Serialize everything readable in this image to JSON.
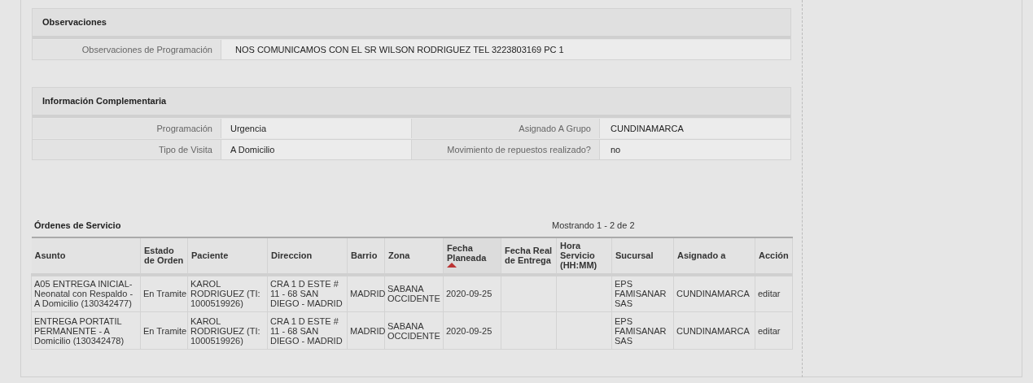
{
  "observaciones": {
    "title": "Observaciones",
    "rows": [
      {
        "label": "Observaciones de Programación",
        "value": "NOS COMUNICAMOS CON EL SR WILSON RODRIGUEZ TEL 3223803169 PC 1"
      }
    ]
  },
  "informacion_complementaria": {
    "title": "Información Complementaria",
    "rows": [
      [
        {
          "label": "Programación",
          "value": "Urgencia"
        },
        {
          "label": "Asignado A Grupo",
          "value": "CUNDINAMARCA"
        }
      ],
      [
        {
          "label": "Tipo de Visita",
          "value": "A Domicilio"
        },
        {
          "label": "Movimiento de repuestos realizado?",
          "value": "no"
        }
      ]
    ]
  },
  "ordenes": {
    "title": "Órdenes de Servicio",
    "paging": "Mostrando 1 - 2 de 2",
    "columns": [
      {
        "label": "Asunto",
        "sorted": false
      },
      {
        "label": "Estado de Orden",
        "sorted": false
      },
      {
        "label": "Paciente",
        "sorted": false
      },
      {
        "label": "Direccion",
        "sorted": false
      },
      {
        "label": "Barrio",
        "sorted": false
      },
      {
        "label": "Zona",
        "sorted": false
      },
      {
        "label": "Fecha Planeada",
        "sorted": true
      },
      {
        "label": "Fecha Real de Entrega",
        "sorted": false
      },
      {
        "label": "Hora Servicio (HH:MM)",
        "sorted": false
      },
      {
        "label": "Sucursal",
        "sorted": false
      },
      {
        "label": "Asignado a",
        "sorted": false
      },
      {
        "label": "Acción",
        "sorted": false
      }
    ],
    "rows": [
      {
        "asunto": "A05 ENTREGA INICIAL-Neonatal con Respaldo - A Domicilio (130342477)",
        "estado": "En Tramite",
        "paciente": "KAROL RODRIGUEZ (TI: 1000519926)",
        "direccion": "CRA 1 D ESTE # 11 - 68 SAN DIEGO - MADRID",
        "barrio": "MADRID",
        "zona": "SABANA OCCIDENTE",
        "fecha_planeada": "2020-09-25",
        "sucursal": "EPS FAMISANAR SAS",
        "asignado": "CUNDINAMARCA",
        "accion": "editar"
      },
      {
        "asunto": "ENTREGA PORTATIL PERMANENTE - A Domicilio (130342478)",
        "estado": "En Tramite",
        "paciente": "KAROL RODRIGUEZ (TI: 1000519926)",
        "direccion": "CRA 1 D ESTE # 11 - 68 SAN DIEGO - MADRID",
        "barrio": "MADRID",
        "zona": "SABANA OCCIDENTE",
        "fecha_planeada": "2020-09-25",
        "sucursal": "EPS FAMISANAR SAS",
        "asignado": "CUNDINAMARCA",
        "accion": "editar"
      }
    ]
  }
}
